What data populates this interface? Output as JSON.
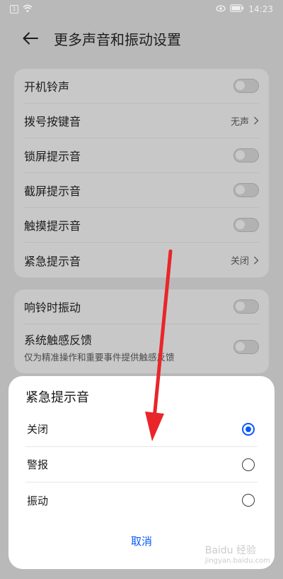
{
  "status_bar": {
    "time": "14:23",
    "battery": "",
    "sim_icon": "sim-icon",
    "wifi_icon": "wifi-icon",
    "eye_icon": "eye-comfort-icon"
  },
  "header": {
    "title": "更多声音和振动设置",
    "back_icon": "back-arrow-icon"
  },
  "settings_group_1": [
    {
      "label": "开机铃声",
      "control": "toggle",
      "on": false
    },
    {
      "label": "拨号按键音",
      "control": "value",
      "value": "无声"
    },
    {
      "label": "锁屏提示音",
      "control": "toggle",
      "on": false
    },
    {
      "label": "截屏提示音",
      "control": "toggle",
      "on": false
    },
    {
      "label": "触摸提示音",
      "control": "toggle",
      "on": false
    },
    {
      "label": "紧急提示音",
      "control": "value",
      "value": "关闭"
    }
  ],
  "settings_group_2": [
    {
      "label": "响铃时振动",
      "control": "toggle",
      "on": false
    },
    {
      "label": "系统触感反馈",
      "sublabel": "仅为精准操作和重要事件提供触感反馈",
      "control": "toggle",
      "on": false
    }
  ],
  "dialog": {
    "title": "紧急提示音",
    "options": [
      {
        "label": "关闭",
        "selected": true
      },
      {
        "label": "警报",
        "selected": false
      },
      {
        "label": "振动",
        "selected": false
      }
    ],
    "cancel_label": "取消"
  },
  "colors": {
    "accent": "#0a59f7",
    "annotation_arrow": "#e8262a"
  },
  "watermark": {
    "text": "Baidu 经验",
    "subtext": "jingyan.baidu.com"
  }
}
